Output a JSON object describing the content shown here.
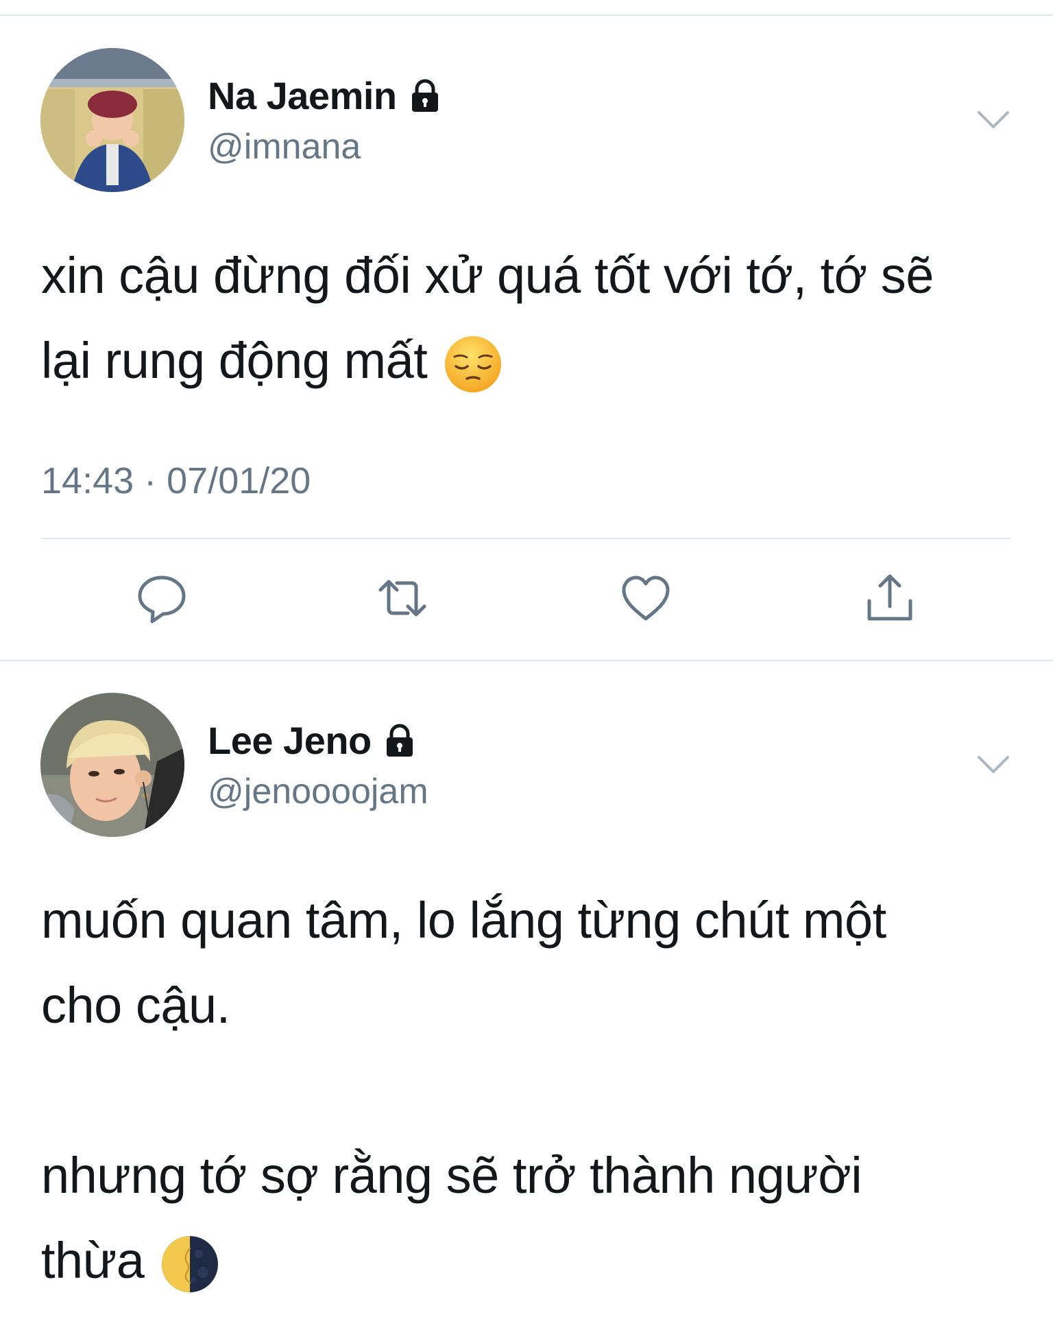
{
  "tweets": [
    {
      "display_name": "Na Jaemin",
      "handle": "@imnana",
      "protected_icon": "lock-icon",
      "menu_icon": "chevron-down-icon",
      "text_lines": [
        "xin cậu đừng đối xử quá tốt với tớ, tớ sẽ",
        "lại rung động mất"
      ],
      "emoji": "pensive-face-emoji",
      "timestamp": "14:43 · 07/01/20",
      "actions": [
        "reply-icon",
        "retweet-icon",
        "like-icon",
        "share-icon"
      ]
    },
    {
      "display_name": "Lee Jeno",
      "handle": "@jenoooojam",
      "protected_icon": "lock-icon",
      "menu_icon": "chevron-down-icon",
      "paragraphs": [
        [
          "muốn quan tâm, lo lắng từng chút một",
          "cho cậu."
        ],
        [
          "nhưng tớ sợ rằng sẽ trở thành người",
          "thừa"
        ]
      ],
      "emoji": "last-quarter-moon-emoji"
    }
  ],
  "colors": {
    "text": "#14171a",
    "secondary": "#657786",
    "divider": "#e1e8ed"
  }
}
